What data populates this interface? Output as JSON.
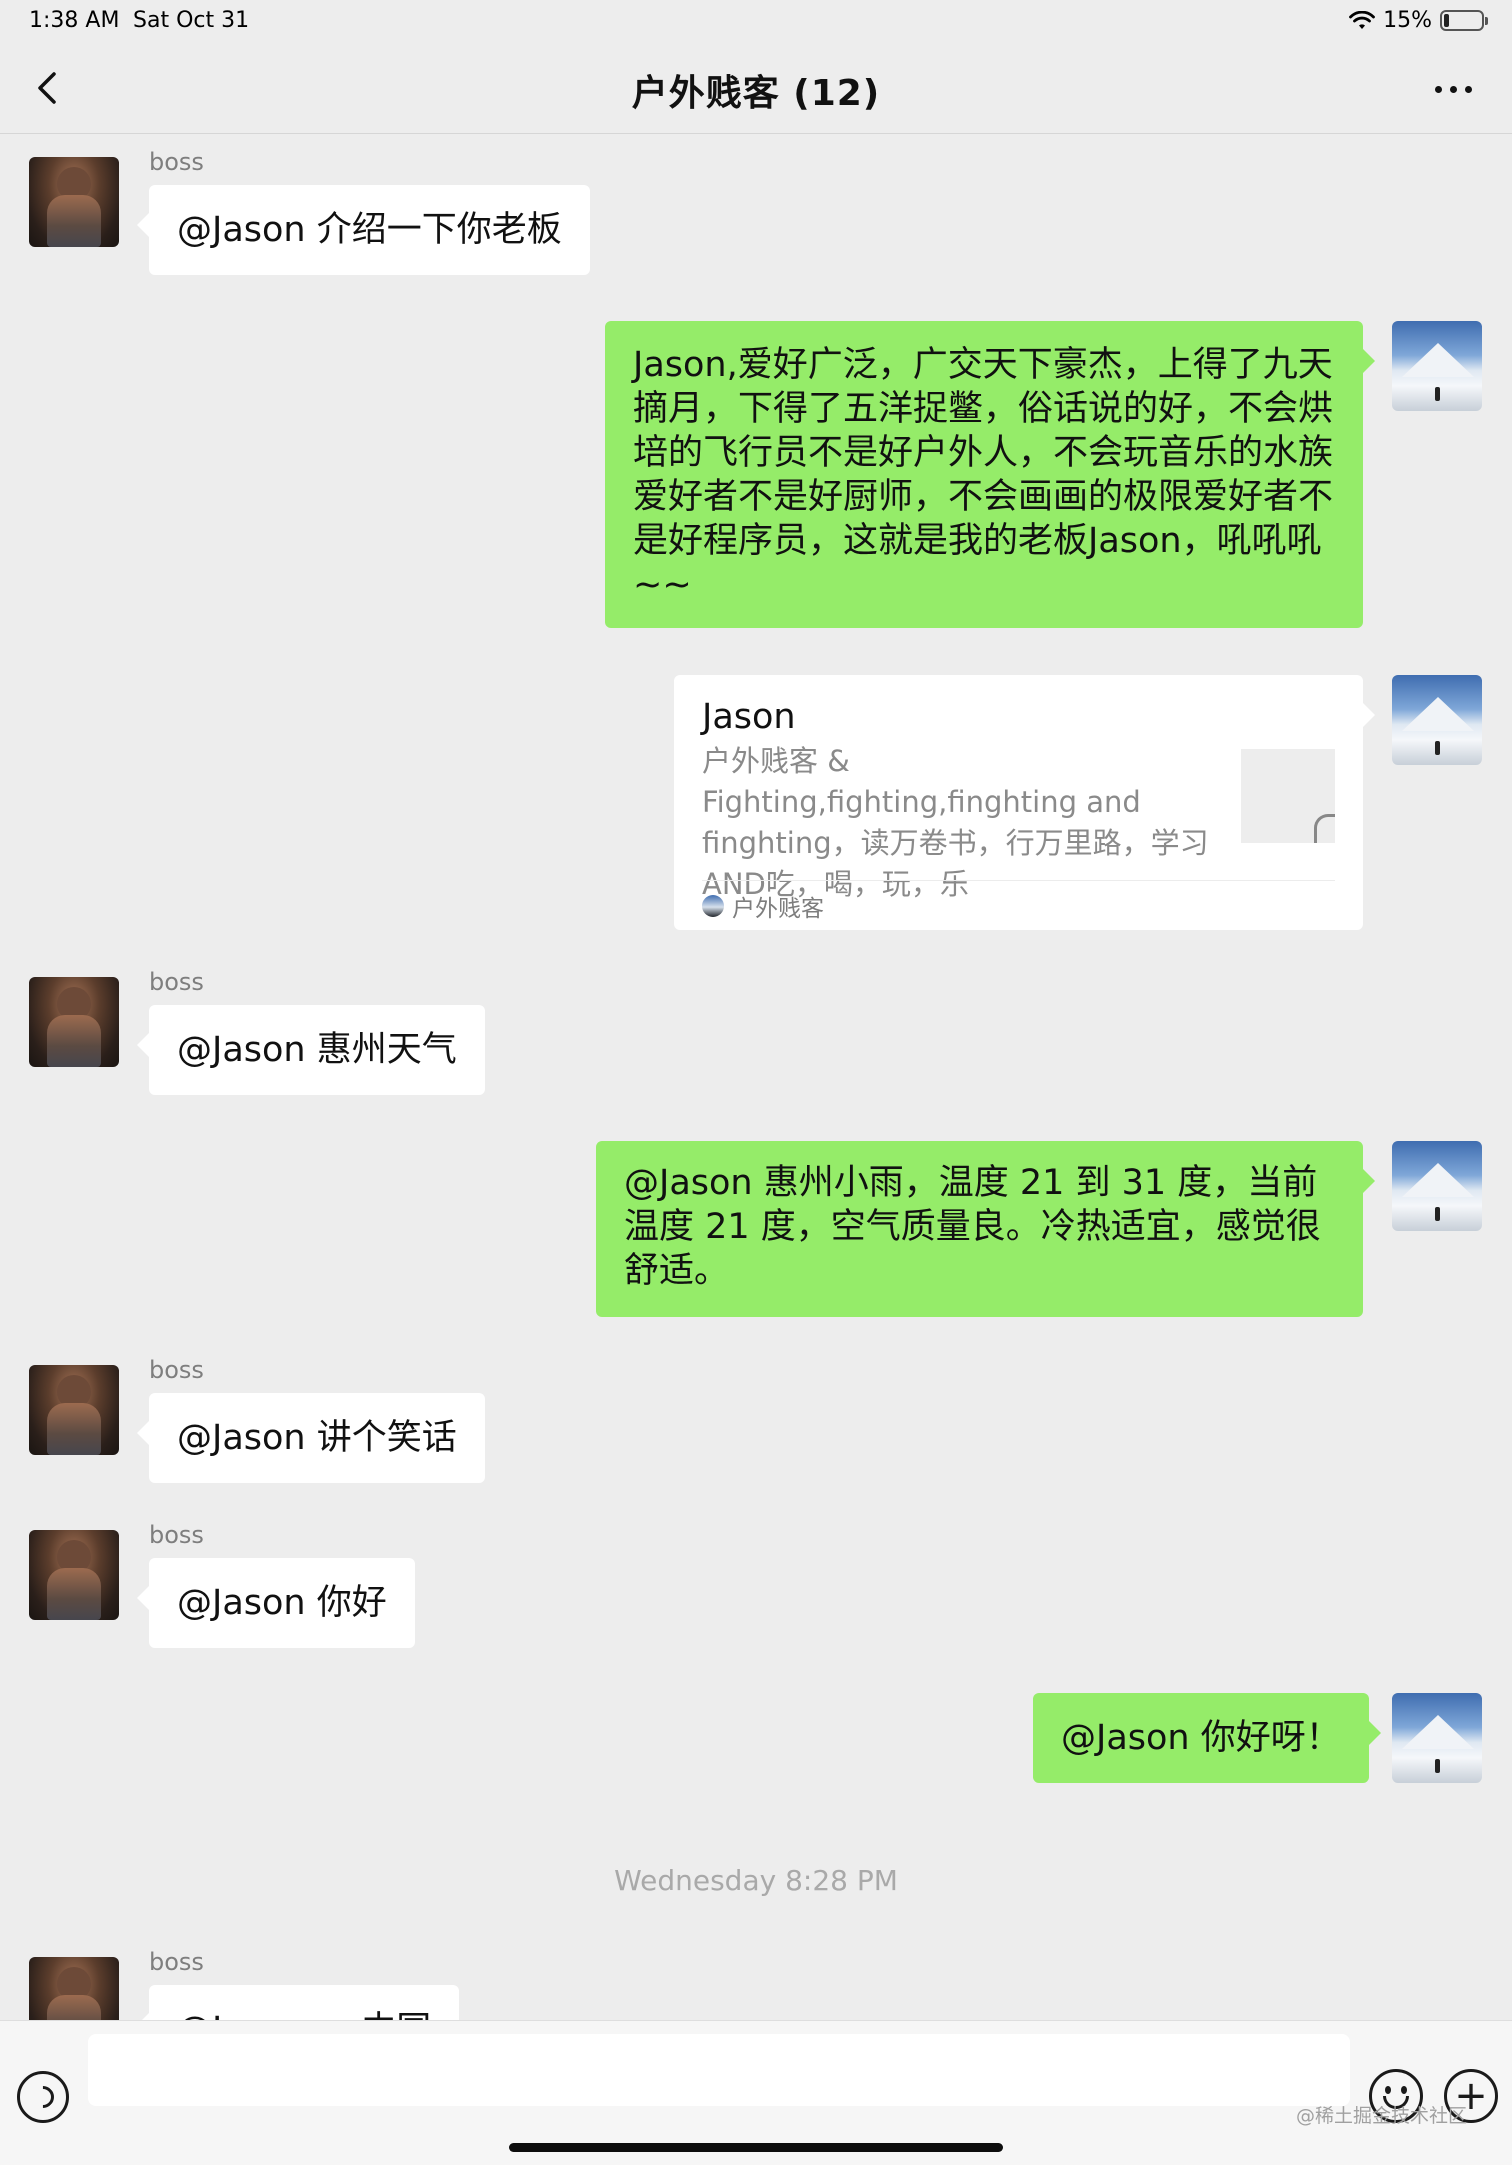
{
  "status_bar": {
    "time": "1:38 AM",
    "date": "Sat Oct 31",
    "battery": "15%",
    "battery_level": 0.15
  },
  "nav": {
    "title": "户外贱客 (12)"
  },
  "messages": [
    {
      "sender": "boss",
      "text": "@Jason 介绍一下你老板"
    },
    {
      "text": "Jason,爱好广泛，广交天下豪杰，上得了九天摘月，下得了五洋捉鳖，俗话说的好，不会烘培的飞行员不是好户外人，不会玩音乐的水族爱好者不是好厨师，不会画画的极限爱好者不是好程序员，这就是我的老板Jason，吼吼吼~~"
    },
    {
      "card": {
        "title": "Jason",
        "description": "户外贱客 & Fighting,fighting,finghting and finghting，读万卷书，行万里路，学习 AND吃，喝，玩，乐",
        "source": "户外贱客"
      }
    },
    {
      "sender": "boss",
      "text": "@Jason 惠州天气"
    },
    {
      "text": "@Jason 惠州小雨，温度 21 到 31 度，当前温度 21 度，空气质量良。冷热适宜，感觉很舒适。"
    },
    {
      "sender": "boss",
      "text": "@Jason 讲个笑话"
    },
    {
      "sender": "boss",
      "text": "@Jason 你好"
    },
    {
      "text": "@Jason 你好呀！"
    },
    {
      "timestamp": "Wednesday 8:28 PM"
    },
    {
      "sender": "boss",
      "text": "@Jason ... 中国"
    }
  ],
  "input": {
    "value": "",
    "watermark": "@稀土掘金技术社区"
  }
}
